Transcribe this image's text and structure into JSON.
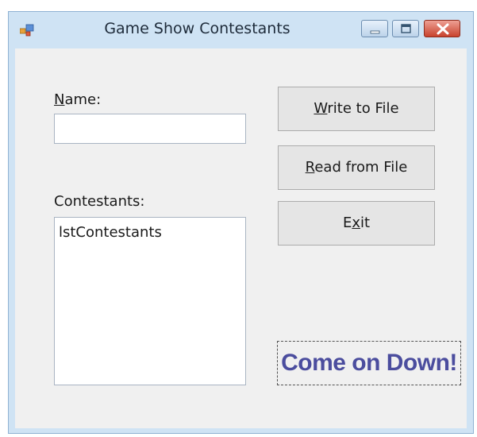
{
  "window": {
    "title": "Game Show Contestants",
    "icons": {
      "app": "app-form-icon",
      "minimize": "minimize-icon",
      "maximize": "maximize-icon",
      "close": "close-icon"
    }
  },
  "form": {
    "name_label": {
      "access_key": "N",
      "rest": "ame:"
    },
    "name_value": "",
    "contestants_label": "Contestants:",
    "contestants_items": [
      "lstContestants"
    ]
  },
  "buttons": {
    "write": {
      "access_key": "W",
      "rest": "rite to File"
    },
    "read": {
      "access_key": "R",
      "rest": "ead from File"
    },
    "exit": {
      "before": "E",
      "access_key": "x",
      "rest": "it"
    }
  },
  "promo_label": "Come on Down!",
  "colors": {
    "window_border": "#cfe3f4",
    "client_bg": "#f0f0f0",
    "close_button": "#c8432e",
    "promo_text": "#4b4d9e"
  }
}
